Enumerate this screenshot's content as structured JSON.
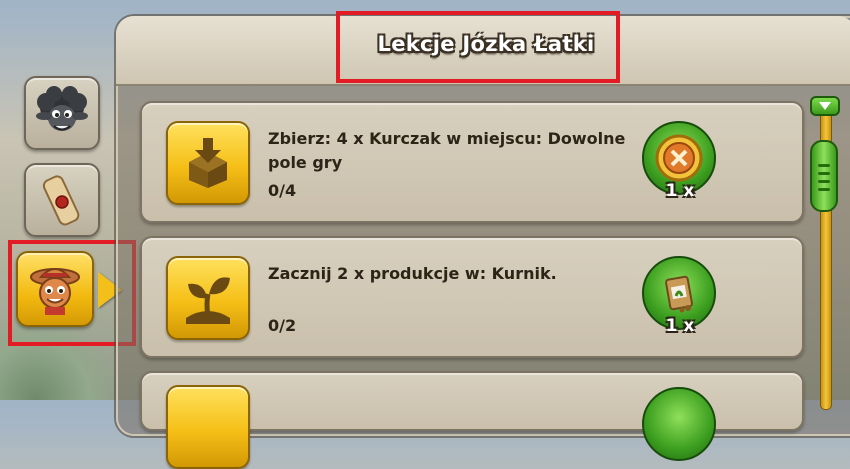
{
  "window": {
    "title": "Lekcje Józka Łatki"
  },
  "side_tabs": [
    {
      "icon": "sheep-icon",
      "active": false
    },
    {
      "icon": "scroll-icon",
      "active": false
    },
    {
      "icon": "farmer-icon",
      "active": true
    }
  ],
  "quests": [
    {
      "icon": "collect-box-icon",
      "text": "Zbierz: 4 x Kurczak w miejscu: Dowolne pole gry",
      "progress": "0/4",
      "reward_icon": "coin-medal-icon",
      "reward_count": "1 x"
    },
    {
      "icon": "sprout-icon",
      "text": "Zacznij 2 x produkcje w: Kurnik.",
      "progress": "0/2",
      "reward_icon": "seed-bag-icon",
      "reward_count": "1 x"
    },
    {
      "icon": "task-icon",
      "text": "",
      "progress": "",
      "reward_icon": "reward-icon",
      "reward_count": ""
    }
  ],
  "colors": {
    "highlight": "#e21b24",
    "accent_gold": "#f5bf17",
    "accent_green": "#3c9e1f"
  }
}
